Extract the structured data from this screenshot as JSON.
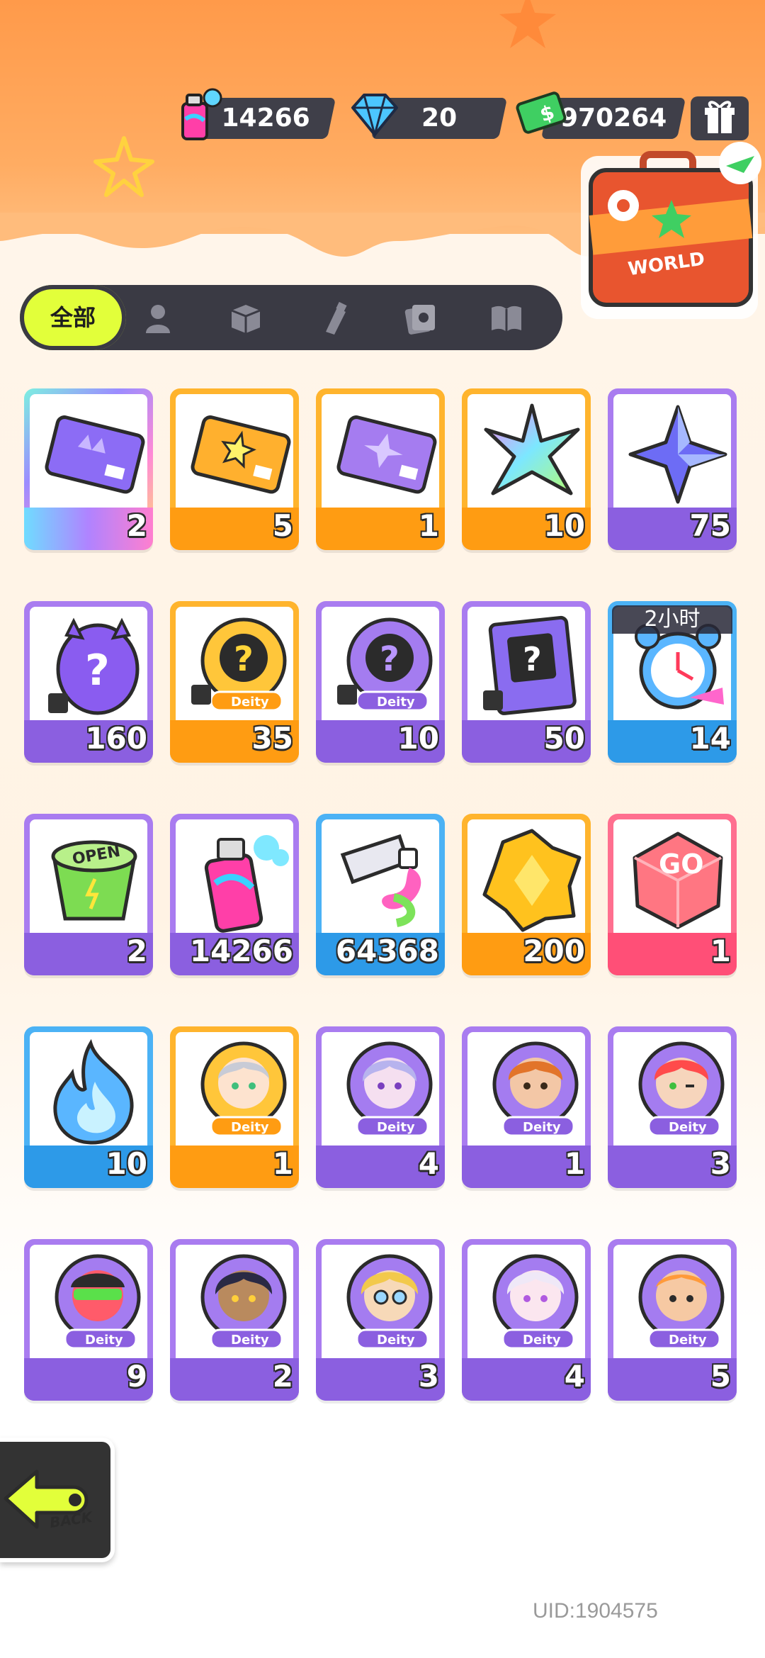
{
  "currencies": [
    {
      "icon": "spray-can-icon",
      "value": "14266"
    },
    {
      "icon": "diamond-icon",
      "value": "20"
    },
    {
      "icon": "cash-icon",
      "value": "970264"
    }
  ],
  "header": {
    "gift_icon": "gift-box-icon",
    "suitcase_label": "WORLD"
  },
  "tabs": [
    {
      "label": "全部",
      "icon": "all",
      "selected": true
    },
    {
      "icon": "person-icon"
    },
    {
      "icon": "box-icon"
    },
    {
      "icon": "paint-tube-icon"
    },
    {
      "icon": "photo-card-icon"
    },
    {
      "icon": "book-icon"
    }
  ],
  "items": [
    {
      "name": "purple-ticket",
      "count": "2",
      "rarity": "rainbow"
    },
    {
      "name": "gold-ticket",
      "count": "5",
      "rarity": "orange"
    },
    {
      "name": "violet-ticket",
      "count": "1",
      "rarity": "orange"
    },
    {
      "name": "rainbow-star-shard",
      "count": "10",
      "rarity": "orange"
    },
    {
      "name": "purple-star-shard",
      "count": "75",
      "rarity": "purple"
    },
    {
      "name": "mystery-egg",
      "count": "160",
      "rarity": "purple"
    },
    {
      "name": "gold-deity-fragment",
      "count": "35",
      "rarity": "orange"
    },
    {
      "name": "purple-deity-fragment",
      "count": "10",
      "rarity": "purple"
    },
    {
      "name": "travel-card-fragment",
      "count": "50",
      "rarity": "purple"
    },
    {
      "name": "alarm-clock",
      "count": "14",
      "rarity": "blue",
      "timer": "2小时"
    },
    {
      "name": "open-cup",
      "count": "2",
      "rarity": "purple"
    },
    {
      "name": "spray-can",
      "count": "14266",
      "rarity": "purple"
    },
    {
      "name": "paint-tube",
      "count": "64368",
      "rarity": "blue"
    },
    {
      "name": "gold-crystal",
      "count": "200",
      "rarity": "orange"
    },
    {
      "name": "go-dice",
      "count": "1",
      "rarity": "pink"
    },
    {
      "name": "blue-flame",
      "count": "10",
      "rarity": "blue"
    },
    {
      "name": "deity-silver-hair",
      "count": "1",
      "rarity": "orange"
    },
    {
      "name": "deity-lavender-hair",
      "count": "4",
      "rarity": "purple"
    },
    {
      "name": "deity-orange-hair",
      "count": "1",
      "rarity": "purple"
    },
    {
      "name": "deity-red-hair",
      "count": "3",
      "rarity": "purple"
    },
    {
      "name": "deity-green-mask",
      "count": "9",
      "rarity": "purple"
    },
    {
      "name": "deity-dark-hair",
      "count": "2",
      "rarity": "purple"
    },
    {
      "name": "deity-blonde-glasses",
      "count": "3",
      "rarity": "purple"
    },
    {
      "name": "deity-white-hair",
      "count": "4",
      "rarity": "purple"
    },
    {
      "name": "deity-bald-orange",
      "count": "5",
      "rarity": "purple"
    }
  ],
  "deity_label": "Deity",
  "back_label": "BACK",
  "uid": "UID:1904575"
}
